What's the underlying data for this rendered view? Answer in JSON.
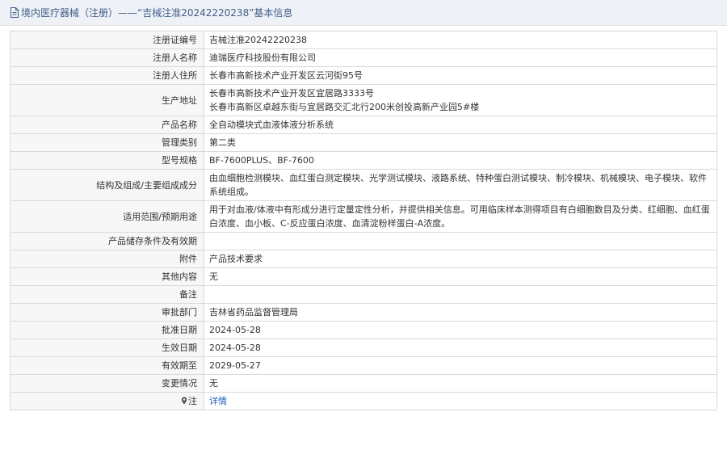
{
  "header": {
    "icon": "document-icon",
    "title": "境内医疗器械（注册）——“吉械注准20242220238”基本信息"
  },
  "rows": [
    {
      "label": "注册证编号",
      "value": "吉械注准20242220238"
    },
    {
      "label": "注册人名称",
      "value": "迪瑞医疗科技股份有限公司"
    },
    {
      "label": "注册人住所",
      "value": "长春市高新技术产业开发区云河街95号"
    },
    {
      "label": "生产地址",
      "lines": [
        "长春市高新技术产业开发区宜居路3333号",
        "长春市高新区卓越东街与宜居路交汇北行200米创投高新产业园5#楼"
      ]
    },
    {
      "label": "产品名称",
      "value": "全自动模块式血液体液分析系统"
    },
    {
      "label": "管理类别",
      "value": "第二类"
    },
    {
      "label": "型号规格",
      "value": "BF-7600PLUS、BF-7600"
    },
    {
      "label": "结构及组成/主要组成成分",
      "value": "由血细胞检测模块、血红蛋白测定模块、光学测试模块、液路系统、特种蛋白测试模块、制冷模块、机械模块、电子模块、软件系统组成。"
    },
    {
      "label": "适用范围/预期用途",
      "value": "用于对血液/体液中有形成分进行定量定性分析，并提供相关信息。可用临床样本测得项目有白细胞数目及分类、红细胞、血红蛋白浓度、血小板、C-反应蛋白浓度、血清淀粉样蛋白-A浓度。"
    },
    {
      "label": "产品储存条件及有效期",
      "value": ""
    },
    {
      "label": "附件",
      "value": "产品技术要求"
    },
    {
      "label": "其他内容",
      "value": "无"
    },
    {
      "label": "备注",
      "value": ""
    },
    {
      "label": "审批部门",
      "value": "吉林省药品监督管理局"
    },
    {
      "label": "批准日期",
      "value": "2024-05-28"
    },
    {
      "label": "生效日期",
      "value": "2024-05-28"
    },
    {
      "label": "有效期至",
      "value": "2029-05-27"
    },
    {
      "label": "变更情况",
      "value": "无"
    },
    {
      "label": "注",
      "value": "详情",
      "icon": "pin-icon"
    }
  ],
  "colors": {
    "header_bg": "#eef1f5",
    "header_text": "#3f5e8a",
    "label_bg": "#f7f7f7",
    "border": "#d9d9d9",
    "link": "#1f5fbf"
  }
}
